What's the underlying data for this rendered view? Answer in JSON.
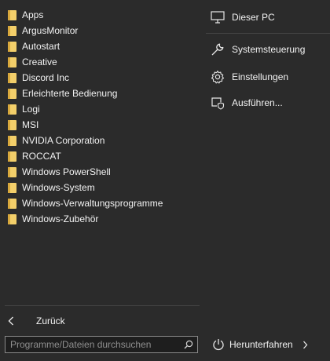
{
  "folders": [
    {
      "label": "Apps"
    },
    {
      "label": "ArgusMonitor"
    },
    {
      "label": "Autostart"
    },
    {
      "label": "Creative"
    },
    {
      "label": "Discord Inc"
    },
    {
      "label": "Erleichterte Bedienung"
    },
    {
      "label": "Logi"
    },
    {
      "label": "MSI"
    },
    {
      "label": "NVIDIA Corporation"
    },
    {
      "label": "ROCCAT"
    },
    {
      "label": "Windows PowerShell"
    },
    {
      "label": "Windows-System"
    },
    {
      "label": "Windows-Verwaltungsprogramme"
    },
    {
      "label": "Windows-Zubehör"
    }
  ],
  "back": {
    "label": "Zurück",
    "icon": "chevron-left-icon"
  },
  "search": {
    "placeholder": "Programme/Dateien durchsuchen",
    "value": "",
    "icon": "search-icon"
  },
  "right": {
    "pc": {
      "label": "Dieser PC",
      "icon": "computer-icon"
    },
    "control_panel": {
      "label": "Systemsteuerung",
      "icon": "wrench-icon"
    },
    "settings": {
      "label": "Einstellungen",
      "icon": "gear-icon"
    },
    "run": {
      "label": "Ausführen...",
      "icon": "run-shield-icon"
    }
  },
  "power": {
    "label": "Herunterfahren",
    "icon": "power-icon",
    "arrow_icon": "chevron-right-icon"
  },
  "colors": {
    "background": "#2b2b2b",
    "folder": "#f3cf6a",
    "text": "#f2f2f2"
  }
}
